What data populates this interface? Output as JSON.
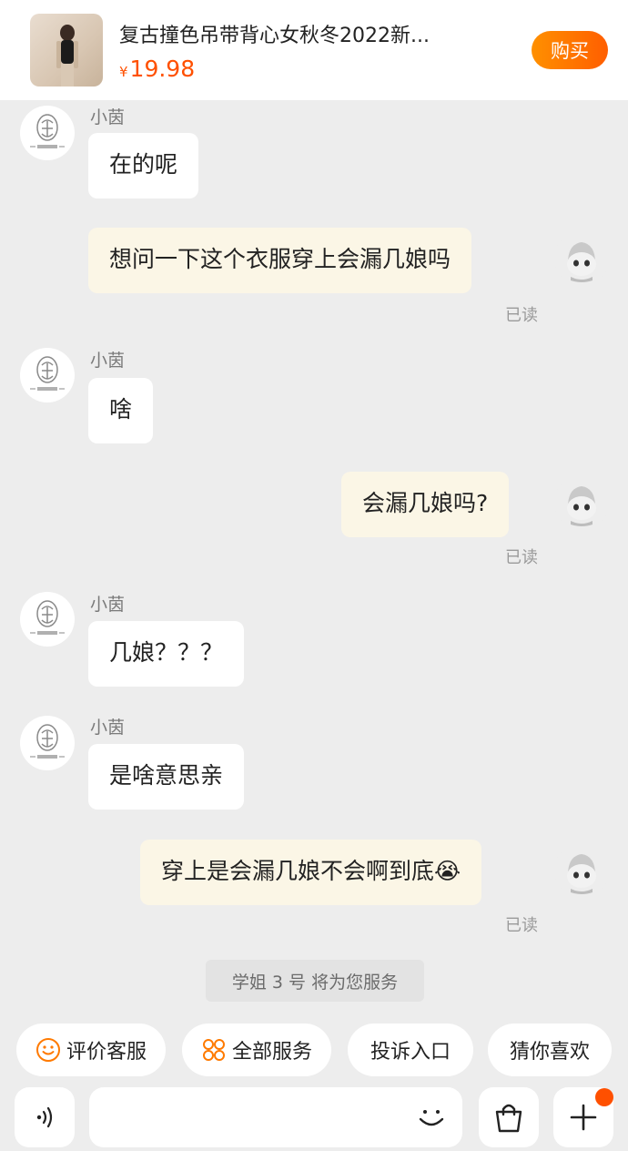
{
  "product": {
    "title": "复古撞色吊带背心女秋冬2022新...",
    "currency": "¥",
    "price": "19.98",
    "buy_label": "购买"
  },
  "messages": [
    {
      "side": "left",
      "sender": "小茵",
      "text": "在的呢"
    },
    {
      "side": "right",
      "text": "想问一下这个衣服穿上会漏几娘吗",
      "status": "已读"
    },
    {
      "side": "left",
      "sender": "小茵",
      "text": "啥"
    },
    {
      "side": "right",
      "text": "会漏几娘吗?",
      "status": "已读"
    },
    {
      "side": "left",
      "sender": "小茵",
      "text": "几娘？？？"
    },
    {
      "side": "left",
      "sender": "小茵",
      "text": "是啥意思亲"
    },
    {
      "side": "right",
      "text": "穿上是会漏几娘不会啊到底",
      "emoji": "😭",
      "status": "已读"
    }
  ],
  "service_notice": "学姐 3 号 将为您服务",
  "quick_actions": [
    {
      "label": "评价客服",
      "icon": "smile-icon"
    },
    {
      "label": "全部服务",
      "icon": "grid-icon"
    },
    {
      "label": "投诉入口"
    },
    {
      "label": "猜你喜欢"
    }
  ],
  "input": {
    "placeholder": ""
  },
  "colors": {
    "accent": "#ff5000",
    "user_bubble": "#fbf6e6",
    "background": "#ededed"
  }
}
